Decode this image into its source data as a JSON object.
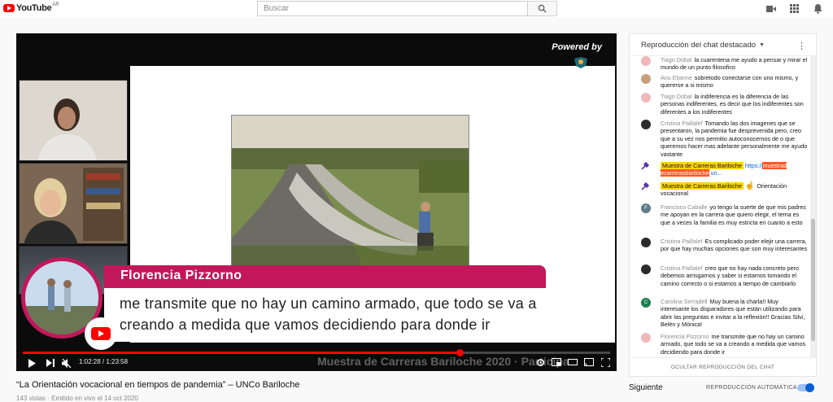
{
  "masthead": {
    "logo_text": "YouTube",
    "region": "AR",
    "search_placeholder": "Buscar",
    "icons": [
      "create-video-icon",
      "apps-icon",
      "notifications-icon"
    ]
  },
  "player": {
    "powered_by": "Powered by",
    "streamyard": "StreamYard",
    "lower_third_name": "Florencia Pizzorno",
    "lower_third_line1": "me transmite que no hay un camino armado, que todo se va a",
    "lower_third_line2": "creando a medida que vamos decidiendo para donde ir",
    "ticker": "Muestra de Carreras Bariloche 2020 · Participa",
    "time_current": "1:02:28",
    "time_total": "1:23:58",
    "time_separator": " / ",
    "progress": 0.744,
    "accent": "#c2185b",
    "progress_color": "#ff0000"
  },
  "video": {
    "title": "“La Orientación vocacional en tiempos de pandemia” – UNCo Bariloche",
    "sub": "143 vistas · Emitido en vivo el 14 oct 2020"
  },
  "chat": {
    "header": "Reproducción del chat destacado",
    "footer": "OCULTAR REPRODUCCIÓN DEL CHAT",
    "messages": [
      {
        "author": "Tiago Dobal",
        "text": "la cuarentena me ayudo a pensar y mirar el mundo de un punto filosofico"
      },
      {
        "author": "Anu Elianne",
        "text": "sobretodo conectarse con uno mismo, y quererse a si mismo"
      },
      {
        "author": "Tiago Dobal",
        "text": "la indiferencia es la diferencia de las personas indiferentes, es decir que los indiferentes son diferentes a los indiferentes"
      },
      {
        "author": "Cristina Paillalef",
        "text": "Tomando las dos imagenes que se presentaron, la pandemia fue desprevenida pero, creo que a su vez nos permitio autoconocernos de o que queremos hacer mas adelante personalmente me ayudo vastante"
      },
      {
        "author": "Muestra de Carreras Bariloche",
        "text": "https://",
        "link": "muestrad ecarrerasbariloche",
        "tail": "un..."
      },
      {
        "author": "Muestra de Carreras Bariloche",
        "text": "Orientación vocacional"
      },
      {
        "author": "Francisco Caballe",
        "text": "yo tengo la suerte de que mis padres me apoyan en la carrera que quiero elegir, el tema es que a veces la familia es muy estricta en cuanto a esto"
      },
      {
        "author": "Cristina Paillalef",
        "text": "Es complicado poder elejir una carrera, por que hay muchas opciones que son muy interesantes"
      },
      {
        "author": "Cristina Paillalef",
        "text": "creo que no hay nada concreto pero debemos arrisgarnos y saber si estamos tomando el camino correcto o si estamos a tiempo de cambiarlo"
      },
      {
        "author": "Carolina Serradell",
        "text": "Muy buena la charla!! Muy interesante los disparadores que están utilizando para abrir las preguntas e invitar a la reflexión!! Gracias Silvi, Belén y Mónica!"
      },
      {
        "author": "Florencia Pizzorno",
        "text": "me transmite que no hay un camino armado, que todo se va a creando a medida que vamos decidiendo para donde ir"
      }
    ]
  },
  "up_next": {
    "label": "Siguiente",
    "autoplay": "REPRODUCCIÓN AUTOMÁTICA",
    "autoplay_on": true
  }
}
